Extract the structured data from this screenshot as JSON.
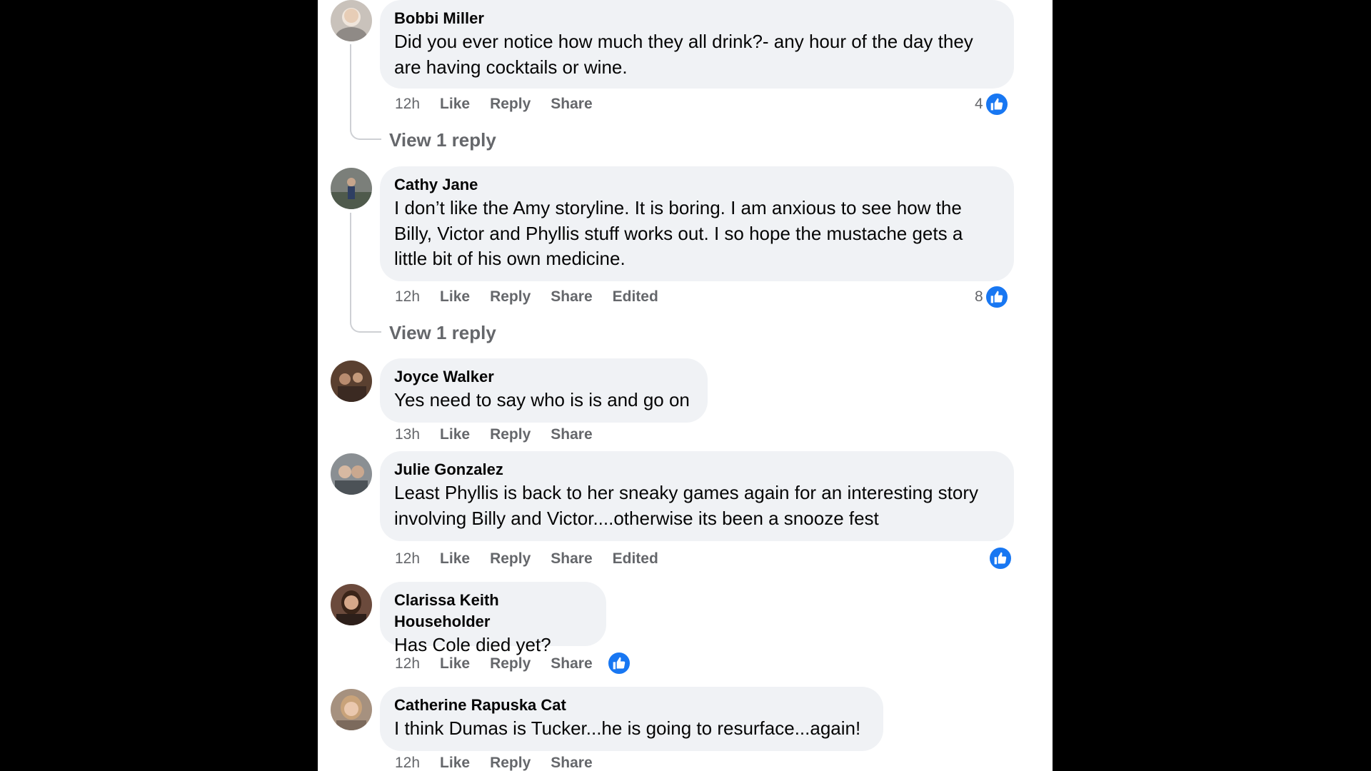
{
  "colors": {
    "bubble": "#f0f2f5",
    "muted_text": "#65676b",
    "primary_text": "#050505",
    "like_blue": "#1877f2",
    "thread_line": "#ced0d4"
  },
  "comments": [
    {
      "author": "Bobbi Miller",
      "text": "Did you ever notice how much they all drink?- any hour of the day they are having cocktails or wine.",
      "time": "12h",
      "like_label": "Like",
      "reply_label": "Reply",
      "share_label": "Share",
      "reaction_count": "4",
      "reaction_icon": "thumbs-up-icon",
      "view_replies": "View 1 reply"
    },
    {
      "author": "Cathy Jane",
      "text": "I don’t like the Amy storyline. It is boring. I am anxious to see how the Billy, Victor and Phyllis stuff works out. I so hope the mustache gets a little bit of his own medicine.",
      "time": "12h",
      "like_label": "Like",
      "reply_label": "Reply",
      "share_label": "Share",
      "edited_label": "Edited",
      "reaction_count": "8",
      "reaction_icon": "thumbs-up-icon",
      "view_replies": "View 1 reply"
    },
    {
      "author": "Joyce Walker",
      "text": "Yes need to say who is is and go on",
      "time": "13h",
      "like_label": "Like",
      "reply_label": "Reply",
      "share_label": "Share"
    },
    {
      "author": "Julie Gonzalez",
      "text": "Least Phyllis is back to her sneaky games again for an interesting story involving Billy and Victor....otherwise its been a snooze fest",
      "time": "12h",
      "like_label": "Like",
      "reply_label": "Reply",
      "share_label": "Share",
      "edited_label": "Edited",
      "reaction_icon": "thumbs-up-icon"
    },
    {
      "author": "Clarissa Keith Householder",
      "text": "Has Cole died yet?",
      "time": "12h",
      "like_label": "Like",
      "reply_label": "Reply",
      "share_label": "Share",
      "reaction_icon": "thumbs-up-icon"
    },
    {
      "author": "Catherine Rapuska Cat",
      "text": "I think Dumas is Tucker...he is going to resurface...again!",
      "time": "12h",
      "like_label": "Like",
      "reply_label": "Reply",
      "share_label": "Share"
    }
  ]
}
